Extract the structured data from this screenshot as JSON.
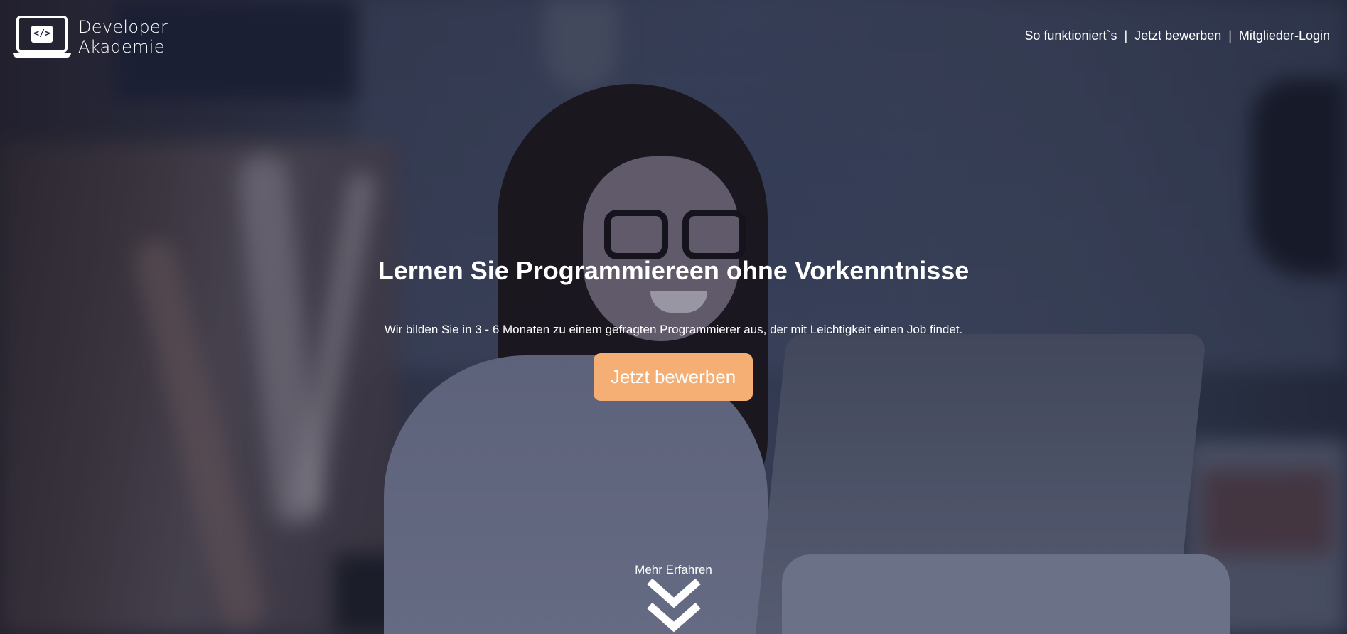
{
  "brand": {
    "line1": "Developer",
    "line2": "Akademie",
    "icon": "code-laptop-icon",
    "icon_glyph": "</>"
  },
  "nav": {
    "items": [
      {
        "label": "So funktioniert`s"
      },
      {
        "label": "Jetzt bewerben"
      },
      {
        "label": "Mitglieder-Login"
      }
    ],
    "separator": "|"
  },
  "hero": {
    "headline": "Lernen Sie Programmiereen ohne Vorkenntnisse",
    "subline": "Wir bilden Sie in 3 - 6 Monaten zu einem gefragten Programmierer aus, der mit Leichtigkeit einen Job findet.",
    "cta_label": "Jetzt bewerben",
    "more_label": "Mehr Erfahren",
    "more_icon": "double-chevron-down-icon"
  },
  "colors": {
    "accent": "#f5ae73",
    "text": "#ffffff"
  }
}
